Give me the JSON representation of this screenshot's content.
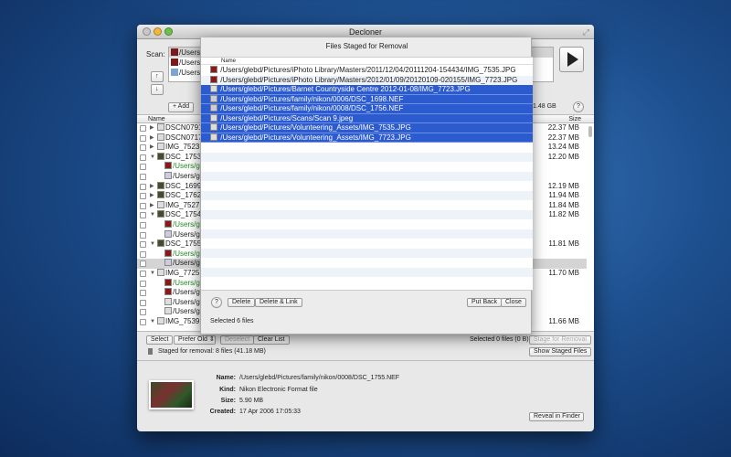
{
  "window": {
    "title": "Decloner"
  },
  "scan": {
    "label": "Scan:",
    "paths": [
      "/Users/",
      "/Users/",
      "/Users/"
    ],
    "add_label": "+ Add",
    "free_space": "1.48 GB",
    "up": "↑",
    "down": "↓",
    "help": "?"
  },
  "list": {
    "header_name": "Name",
    "header_size": "Size",
    "rows": [
      {
        "name": "DSCN0791.",
        "size": "22.37 MB",
        "level": 0,
        "disc": "▶",
        "kind": "doc"
      },
      {
        "name": "DSCN0717.",
        "size": "22.37 MB",
        "level": 0,
        "disc": "▶",
        "kind": "doc"
      },
      {
        "name": "IMG_7523.J",
        "size": "13.24 MB",
        "level": 0,
        "disc": "▶",
        "kind": "doc"
      },
      {
        "name": "DSC_1753.N",
        "size": "12.20 MB",
        "level": 0,
        "disc": "▼",
        "kind": "img"
      },
      {
        "name": "/Users/g",
        "size": "",
        "level": 1,
        "disc": "",
        "kind": "photo",
        "green": true
      },
      {
        "name": "/Users/g",
        "size": "",
        "level": 1,
        "disc": "",
        "kind": "nef"
      },
      {
        "name": "DSC_1699.N",
        "size": "12.19 MB",
        "level": 0,
        "disc": "▶",
        "kind": "img"
      },
      {
        "name": "DSC_1762.N",
        "size": "11.94 MB",
        "level": 0,
        "disc": "▶",
        "kind": "img"
      },
      {
        "name": "IMG_7527.J",
        "size": "11.84 MB",
        "level": 0,
        "disc": "▶",
        "kind": "doc"
      },
      {
        "name": "DSC_1754.N",
        "size": "11.82 MB",
        "level": 0,
        "disc": "▼",
        "kind": "img"
      },
      {
        "name": "/Users/g",
        "size": "",
        "level": 1,
        "disc": "",
        "kind": "photo",
        "green": true
      },
      {
        "name": "/Users/g",
        "size": "",
        "level": 1,
        "disc": "",
        "kind": "nef"
      },
      {
        "name": "DSC_1755.N",
        "size": "11.81 MB",
        "level": 0,
        "disc": "▼",
        "kind": "img"
      },
      {
        "name": "/Users/g",
        "size": "",
        "level": 1,
        "disc": "",
        "kind": "photo",
        "green": true
      },
      {
        "name": "/Users/g",
        "size": "",
        "level": 1,
        "disc": "",
        "kind": "nef",
        "selected": true
      },
      {
        "name": "IMG_7725.J",
        "size": "11.70 MB",
        "level": 0,
        "disc": "▼",
        "kind": "doc"
      },
      {
        "name": "/Users/g",
        "size": "",
        "level": 1,
        "disc": "",
        "kind": "photo",
        "green": true
      },
      {
        "name": "/Users/g",
        "size": "",
        "level": 1,
        "disc": "",
        "kind": "photo"
      },
      {
        "name": "/Users/g",
        "size": "",
        "level": 1,
        "disc": "",
        "kind": "doc"
      },
      {
        "name": "/Users/g",
        "size": "",
        "level": 1,
        "disc": "",
        "kind": "doc"
      },
      {
        "name": "IMG_7539.J",
        "size": "11.66 MB",
        "level": 0,
        "disc": "▼",
        "kind": "doc"
      }
    ]
  },
  "toolbar": {
    "select": "Select",
    "prefer": "Prefer Old",
    "deselect": "Deselect",
    "clear": "Clear List",
    "selected_status": "Selected 0 files (0 B)",
    "stage": "Stage for Removal",
    "staged_status": "Staged for removal: 8 files (41.18 MB)",
    "show_staged": "Show Staged Files"
  },
  "info": {
    "name_label": "Name:",
    "name": "/Users/glebd/Pictures/family/nikon/0008/DSC_1755.NEF",
    "kind_label": "Kind:",
    "kind": "Nikon Electronic Format file",
    "size_label": "Size:",
    "size": "5.90 MB",
    "created_label": "Created:",
    "created": "17 Apr 2006 17:05:33",
    "reveal": "Reveal in Finder"
  },
  "sheet": {
    "title": "Files Staged for Removal",
    "header_name": "Name",
    "rows": [
      {
        "path": "/Users/glebd/Pictures/iPhoto Library/Masters/2011/12/04/20111204-154434/IMG_7535.JPG",
        "selected": false,
        "kind": "photo"
      },
      {
        "path": "/Users/glebd/Pictures/iPhoto Library/Masters/2012/01/09/20120109-020155/IMG_7723.JPG",
        "selected": false,
        "kind": "photo"
      },
      {
        "path": "/Users/glebd/Pictures/Barnet Countryside Centre 2012-01-08/IMG_7723.JPG",
        "selected": true,
        "kind": "doc"
      },
      {
        "path": "/Users/glebd/Pictures/family/nikon/0006/DSC_1698.NEF",
        "selected": true,
        "kind": "nef"
      },
      {
        "path": "/Users/glebd/Pictures/family/nikon/0008/DSC_1756.NEF",
        "selected": true,
        "kind": "nef"
      },
      {
        "path": "/Users/glebd/Pictures/Scans/Scan 9.jpeg",
        "selected": true,
        "kind": "doc"
      },
      {
        "path": "/Users/glebd/Pictures/Volunteering_Assets/IMG_7535.JPG",
        "selected": true,
        "kind": "doc"
      },
      {
        "path": "/Users/glebd/Pictures/Volunteering_Assets/IMG_7723.JPG",
        "selected": true,
        "kind": "doc"
      }
    ],
    "help": "?",
    "delete": "Delete",
    "delete_link": "Delete & Link",
    "put_back": "Put Back",
    "close": "Close",
    "status": "Selected 6 files"
  }
}
